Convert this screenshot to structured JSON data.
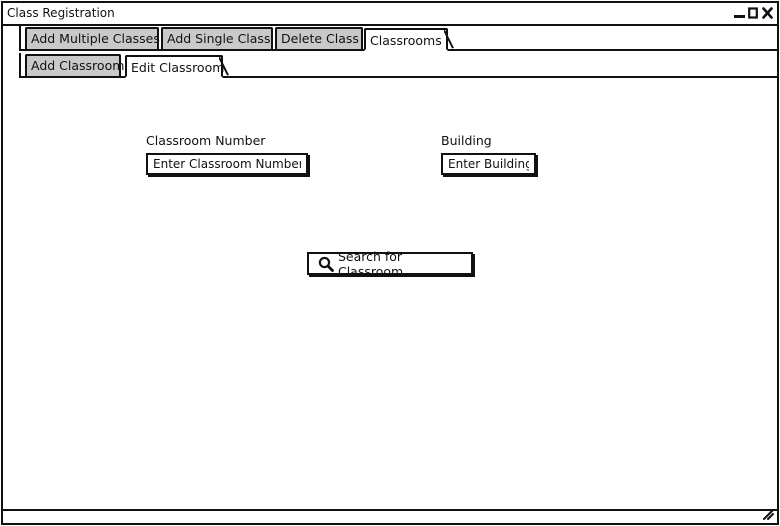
{
  "window": {
    "title": "Class Registration",
    "controls": [
      "minimize",
      "maximize",
      "close"
    ]
  },
  "main_tabs": [
    {
      "label": "Add Multiple Classes",
      "active": false
    },
    {
      "label": "Add Single Class",
      "active": false
    },
    {
      "label": "Delete Class",
      "active": false
    },
    {
      "label": "Classrooms",
      "active": true
    }
  ],
  "sub_tabs": [
    {
      "label": "Add Classroom",
      "active": false
    },
    {
      "label": "Edit Classroom",
      "active": true
    }
  ],
  "form": {
    "classroom_number": {
      "label": "Classroom Number",
      "placeholder": "Enter Classroom Number",
      "value": ""
    },
    "building": {
      "label": "Building",
      "placeholder": "Enter Building",
      "value": ""
    },
    "search_button": {
      "label": "Search for Classroom",
      "icon": "search-icon"
    }
  },
  "colors": {
    "inactive_tab": "#c9c9c9",
    "border": "#111111",
    "background": "#ffffff"
  }
}
